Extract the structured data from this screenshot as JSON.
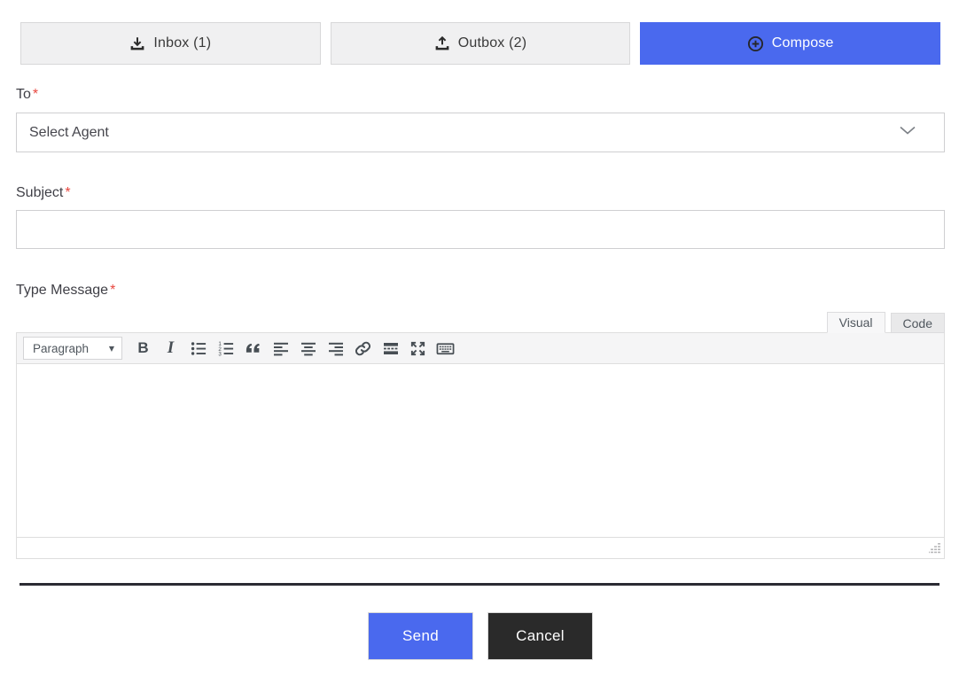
{
  "mailbox_nav": {
    "inbox_label": "Inbox (1)",
    "outbox_label": "Outbox (2)",
    "compose_label": "Compose"
  },
  "compose_form": {
    "to_label": "To",
    "required_mark": "*",
    "to_value": "Select Agent",
    "subject_label": "Subject",
    "subject_value": "",
    "message_label": "Type Message",
    "message_value": ""
  },
  "editor": {
    "tabs": [
      {
        "label": "Visual",
        "active": true
      },
      {
        "label": "Code",
        "active": false
      }
    ],
    "paragraph_dropdown": "Paragraph",
    "paragraph_caret": "▼",
    "bold_glyph": "B",
    "italic_glyph": "I",
    "toolbar_icons": [
      "bold-icon",
      "italic-icon",
      "bullet-list-icon",
      "numbered-list-icon",
      "blockquote-icon",
      "align-left-icon",
      "align-center-icon",
      "align-right-icon",
      "link-icon",
      "read-more-icon",
      "fullscreen-icon",
      "keyboard-icon"
    ]
  },
  "actions": {
    "send_label": "Send",
    "cancel_label": "Cancel"
  },
  "icons": {
    "inbox": "download-icon",
    "outbox": "upload-icon",
    "compose": "plus-circle-icon",
    "agent_select": "chevron-down-icon",
    "editor_resize": "resize-grip-icon"
  },
  "colors": {
    "accent_blue": "#4a69ee",
    "dark_button": "#2a2a2a",
    "divider": "#2b2b33",
    "required_red": "#e8473f",
    "nav_button_bg": "#f0f0f1",
    "toolbar_bg": "#f5f5f6",
    "icon_slate": "#474e54"
  }
}
